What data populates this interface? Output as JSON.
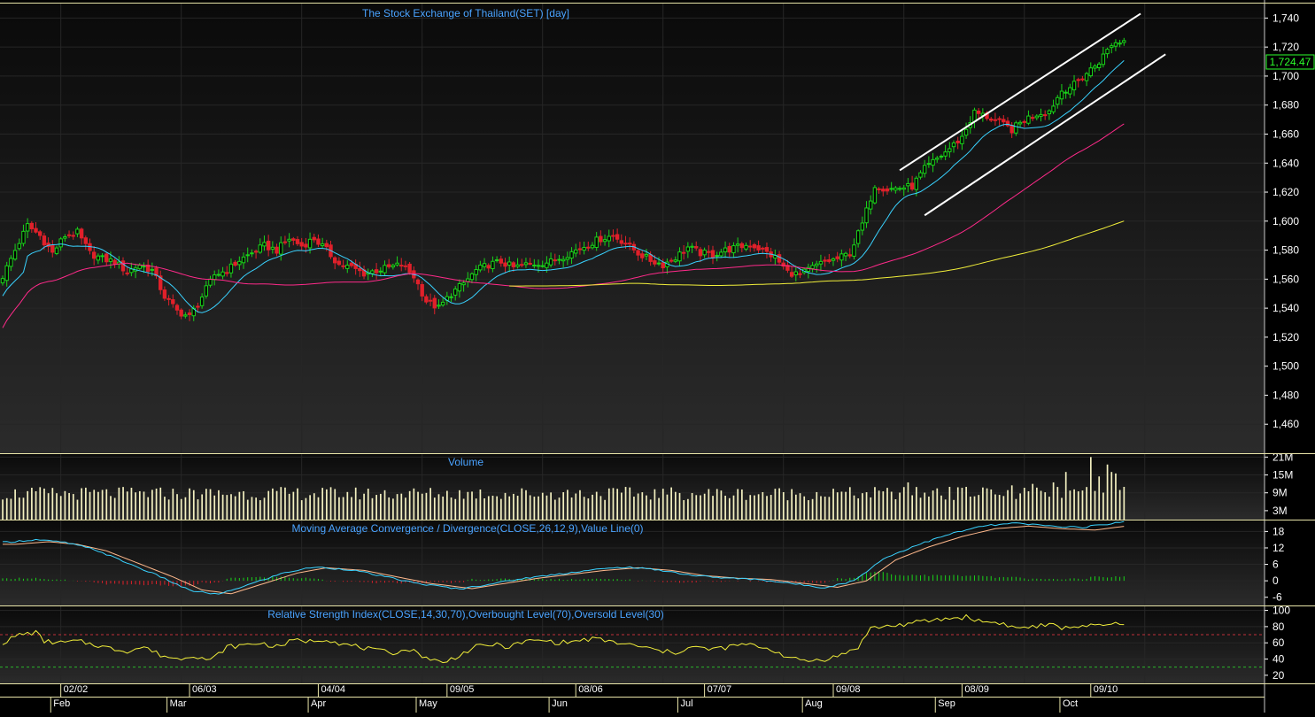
{
  "colors": {
    "background": "#000000",
    "panel_top": "#0a0a0a",
    "panel_bottom": "#2b2b2b",
    "grid": "#262626",
    "axis_text": "#ffffff",
    "title_text": "#4aa3ff",
    "border": "#e8e4a8",
    "candle_up": "#19d419",
    "candle_down": "#e0202a",
    "channel": "#ffffff",
    "ma_short": "#39d2ff",
    "ma_mid": "#ff2a8a",
    "ma_long": "#f2ef3a",
    "volume_bar": "#f3f0c0",
    "macd_line": "#39d2ff",
    "signal_line": "#ffb98c",
    "rsi_line": "#f2ef3a",
    "overbought_line": "#c0303a",
    "oversold_line": "#2ab52a",
    "price_tag_bg": "#000000",
    "price_tag_text": "#2bff2b"
  },
  "chart_data": [
    {
      "type": "candlestick",
      "title": "The Stock Exchange of Thailand(SET) [day]",
      "ylim": [
        1440,
        1750
      ],
      "yticks": [
        1460,
        1480,
        1500,
        1520,
        1540,
        1560,
        1580,
        1600,
        1620,
        1640,
        1660,
        1680,
        1700,
        1720,
        1740
      ],
      "last_price_label": "1,724.47",
      "last_price": 1724.47,
      "close_anchors": [
        [
          0,
          1562
        ],
        [
          3,
          1580
        ],
        [
          6,
          1597
        ],
        [
          9,
          1590
        ],
        [
          12,
          1578
        ],
        [
          15,
          1590
        ],
        [
          18,
          1592
        ],
        [
          21,
          1578
        ],
        [
          24,
          1574
        ],
        [
          27,
          1572
        ],
        [
          30,
          1565
        ],
        [
          33,
          1570
        ],
        [
          36,
          1566
        ],
        [
          39,
          1548
        ],
        [
          42,
          1538
        ],
        [
          45,
          1534
        ],
        [
          48,
          1548
        ],
        [
          51,
          1563
        ],
        [
          54,
          1566
        ],
        [
          57,
          1573
        ],
        [
          60,
          1578
        ],
        [
          63,
          1583
        ],
        [
          66,
          1580
        ],
        [
          69,
          1588
        ],
        [
          72,
          1583
        ],
        [
          75,
          1588
        ],
        [
          78,
          1580
        ],
        [
          81,
          1570
        ],
        [
          84,
          1568
        ],
        [
          87,
          1564
        ],
        [
          90,
          1566
        ],
        [
          93,
          1568
        ],
        [
          96,
          1570
        ],
        [
          99,
          1562
        ],
        [
          102,
          1545
        ],
        [
          105,
          1540
        ],
        [
          108,
          1550
        ],
        [
          111,
          1557
        ],
        [
          114,
          1566
        ],
        [
          117,
          1570
        ],
        [
          120,
          1572
        ],
        [
          123,
          1568
        ],
        [
          126,
          1570
        ],
        [
          129,
          1571
        ],
        [
          132,
          1572
        ],
        [
          135,
          1576
        ],
        [
          138,
          1580
        ],
        [
          141,
          1584
        ],
        [
          144,
          1588
        ],
        [
          147,
          1590
        ],
        [
          150,
          1585
        ],
        [
          153,
          1578
        ],
        [
          156,
          1573
        ],
        [
          159,
          1570
        ],
        [
          162,
          1575
        ],
        [
          165,
          1582
        ],
        [
          168,
          1578
        ],
        [
          171,
          1577
        ],
        [
          174,
          1580
        ],
        [
          177,
          1582
        ],
        [
          180,
          1584
        ],
        [
          183,
          1580
        ],
        [
          186,
          1575
        ],
        [
          189,
          1565
        ],
        [
          192,
          1563
        ],
        [
          195,
          1568
        ],
        [
          198,
          1572
        ],
        [
          201,
          1574
        ],
        [
          204,
          1578
        ],
        [
          207,
          1598
        ],
        [
          210,
          1625
        ],
        [
          213,
          1622
        ],
        [
          216,
          1623
        ],
        [
          219,
          1624
        ],
        [
          222,
          1636
        ],
        [
          225,
          1643
        ],
        [
          228,
          1650
        ],
        [
          231,
          1658
        ],
        [
          234,
          1675
        ],
        [
          237,
          1672
        ],
        [
          240,
          1668
        ],
        [
          243,
          1663
        ],
        [
          246,
          1670
        ],
        [
          249,
          1674
        ],
        [
          252,
          1676
        ],
        [
          255,
          1690
        ],
        [
          258,
          1694
        ],
        [
          261,
          1702
        ],
        [
          264,
          1710
        ],
        [
          267,
          1722
        ],
        [
          270,
          1724.47
        ]
      ],
      "x_ticks": [
        {
          "label": "02/02",
          "index": 14
        },
        {
          "label": "06/03",
          "index": 45
        },
        {
          "label": "04/04",
          "index": 76
        },
        {
          "label": "09/05",
          "index": 107
        },
        {
          "label": "08/06",
          "index": 138
        },
        {
          "label": "07/07",
          "index": 169
        },
        {
          "label": "09/08",
          "index": 200
        },
        {
          "label": "08/09",
          "index": 231
        },
        {
          "label": "09/10",
          "index": 262
        }
      ],
      "month_labels": [
        {
          "label": "Feb",
          "index": 12
        },
        {
          "label": "Mar",
          "index": 40
        },
        {
          "label": "Apr",
          "index": 74
        },
        {
          "label": "May",
          "index": 100
        },
        {
          "label": "Jun",
          "index": 132
        },
        {
          "label": "Jul",
          "index": 163
        },
        {
          "label": "Aug",
          "index": 193
        },
        {
          "label": "Sep",
          "index": 225
        },
        {
          "label": "Oct",
          "index": 255
        }
      ],
      "ma_long_start_index": 122,
      "channel_lines": [
        {
          "from": [
            216,
            1635
          ],
          "to": [
            274,
            1743
          ]
        },
        {
          "from": [
            222,
            1604
          ],
          "to": [
            280,
            1715
          ]
        }
      ]
    },
    {
      "type": "bar",
      "title": "Volume",
      "ylim": [
        0,
        22
      ],
      "yticks": [
        3,
        9,
        15,
        21
      ],
      "ytick_labels": [
        "3M",
        "9M",
        "15M",
        "21M"
      ],
      "spikes": [
        [
          218,
          12.5
        ],
        [
          225,
          10.5
        ],
        [
          228,
          11
        ],
        [
          232,
          11
        ],
        [
          237,
          10.5
        ],
        [
          243,
          11.5
        ],
        [
          248,
          12
        ],
        [
          253,
          12.5
        ],
        [
          256,
          16
        ],
        [
          262,
          21
        ],
        [
          264,
          14.5
        ],
        [
          266,
          18.5
        ],
        [
          267,
          16
        ],
        [
          268,
          15.5
        ],
        [
          270,
          11
        ]
      ]
    },
    {
      "type": "line",
      "title": "Moving Average Convergence / Divergence(CLOSE,26,12,9),Value Line(0)",
      "ylim": [
        -9,
        22
      ],
      "yticks": [
        -6,
        0,
        6,
        12,
        18
      ],
      "macd_anchors": [
        [
          0,
          14
        ],
        [
          8,
          15
        ],
        [
          15,
          14
        ],
        [
          22,
          11.5
        ],
        [
          30,
          6.5
        ],
        [
          38,
          1.5
        ],
        [
          45,
          -3.5
        ],
        [
          52,
          -5
        ],
        [
          60,
          -1
        ],
        [
          68,
          3
        ],
        [
          75,
          5
        ],
        [
          84,
          4
        ],
        [
          92,
          1.5
        ],
        [
          100,
          -1
        ],
        [
          110,
          -3
        ],
        [
          118,
          -1
        ],
        [
          126,
          1
        ],
        [
          134,
          2.5
        ],
        [
          142,
          4
        ],
        [
          150,
          5
        ],
        [
          158,
          4
        ],
        [
          166,
          2
        ],
        [
          174,
          1
        ],
        [
          182,
          0.5
        ],
        [
          190,
          -1
        ],
        [
          198,
          -2.5
        ],
        [
          205,
          0
        ],
        [
          212,
          8
        ],
        [
          220,
          13
        ],
        [
          228,
          17
        ],
        [
          236,
          20
        ],
        [
          244,
          21
        ],
        [
          252,
          20
        ],
        [
          260,
          19.5
        ],
        [
          270,
          21.5
        ]
      ],
      "signal_offset": 3,
      "signal_scale": 0.95
    },
    {
      "type": "line",
      "title": "Relative Strength Index(CLOSE,14,30,70),Overbought Level(70),Oversold Level(30)",
      "ylim": [
        10,
        105
      ],
      "yticks": [
        20,
        40,
        60,
        80,
        100
      ],
      "overbought": 70,
      "oversold": 30,
      "rsi_anchors": [
        [
          0,
          60
        ],
        [
          4,
          70
        ],
        [
          8,
          73
        ],
        [
          10,
          62
        ],
        [
          14,
          60
        ],
        [
          18,
          62
        ],
        [
          22,
          58
        ],
        [
          26,
          53
        ],
        [
          30,
          50
        ],
        [
          34,
          55
        ],
        [
          38,
          45
        ],
        [
          42,
          40
        ],
        [
          46,
          45
        ],
        [
          50,
          38
        ],
        [
          54,
          55
        ],
        [
          58,
          57
        ],
        [
          62,
          60
        ],
        [
          66,
          55
        ],
        [
          70,
          63
        ],
        [
          74,
          62
        ],
        [
          78,
          65
        ],
        [
          82,
          58
        ],
        [
          86,
          55
        ],
        [
          90,
          50
        ],
        [
          94,
          48
        ],
        [
          98,
          52
        ],
        [
          102,
          42
        ],
        [
          106,
          35
        ],
        [
          110,
          45
        ],
        [
          114,
          55
        ],
        [
          118,
          58
        ],
        [
          122,
          55
        ],
        [
          126,
          62
        ],
        [
          130,
          63
        ],
        [
          134,
          60
        ],
        [
          138,
          62
        ],
        [
          142,
          65
        ],
        [
          146,
          62
        ],
        [
          150,
          58
        ],
        [
          154,
          55
        ],
        [
          158,
          50
        ],
        [
          162,
          48
        ],
        [
          166,
          55
        ],
        [
          170,
          52
        ],
        [
          174,
          54
        ],
        [
          178,
          58
        ],
        [
          182,
          56
        ],
        [
          186,
          50
        ],
        [
          190,
          40
        ],
        [
          194,
          38
        ],
        [
          198,
          40
        ],
        [
          202,
          45
        ],
        [
          206,
          55
        ],
        [
          209,
          78
        ],
        [
          212,
          80
        ],
        [
          216,
          82
        ],
        [
          220,
          85
        ],
        [
          224,
          88
        ],
        [
          228,
          90
        ],
        [
          232,
          92
        ],
        [
          236,
          86
        ],
        [
          240,
          85
        ],
        [
          244,
          78
        ],
        [
          248,
          80
        ],
        [
          252,
          82
        ],
        [
          256,
          78
        ],
        [
          260,
          82
        ],
        [
          264,
          80
        ],
        [
          268,
          84
        ],
        [
          270,
          80
        ]
      ]
    }
  ]
}
